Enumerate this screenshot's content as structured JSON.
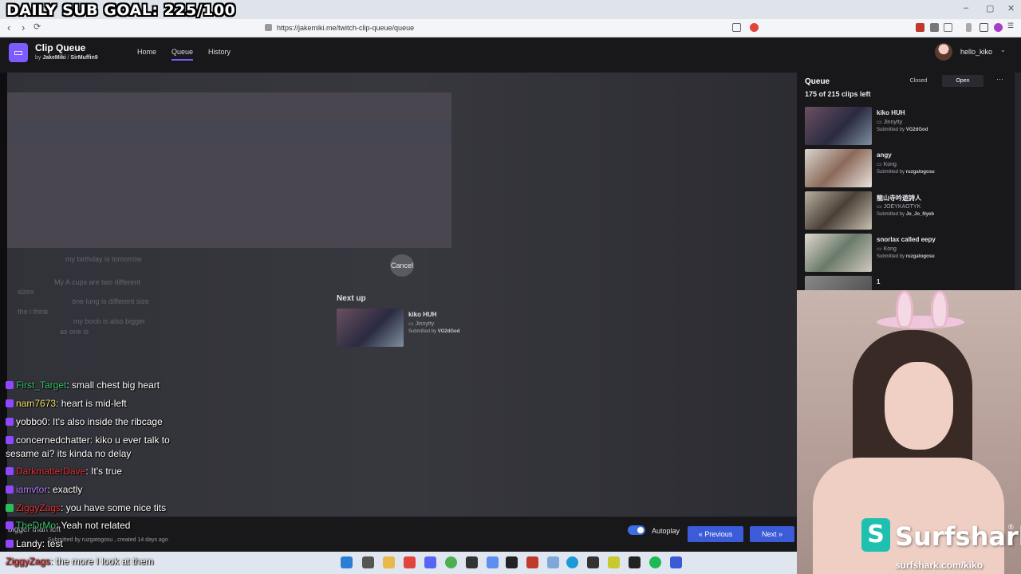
{
  "overlay": {
    "goal_text": "DAILY SUB GOAL: 225/100"
  },
  "browser": {
    "url": "https://jakemiki.me/twitch-clip-queue/queue",
    "nav": {
      "back": "‹",
      "forward": "›",
      "reload": "⟳"
    },
    "window": {
      "minimize": "–",
      "maximize": "▢",
      "close": "✕"
    }
  },
  "app": {
    "logo": "▭",
    "title": "Clip Queue",
    "by_prefix": "by",
    "author1": "JakeMiki",
    "separator": "/",
    "author2": "SirMuffin9",
    "nav": [
      {
        "label": "Home"
      },
      {
        "label": "Queue"
      },
      {
        "label": "History"
      }
    ],
    "user": {
      "name": "hello_kiko",
      "caret": "⌄"
    }
  },
  "player": {
    "cancel_label": "Cancel",
    "next_up_label": "Next up",
    "next_up": {
      "title": "kiko HUH",
      "creator": "Jinnytty",
      "submitted_prefix": "Submitted by",
      "submitted_by": "VG2dGod"
    },
    "clip_meta": "Submitted by ruzgatogosu , created 14 days ago"
  },
  "chat": [
    {
      "user": "First_Target",
      "message": "small chest big heart",
      "color": "#39c46a",
      "badge": "purple"
    },
    {
      "user": "nam7673",
      "message": "heart is mid-left",
      "color": "#f5e46b",
      "badge": "purple"
    },
    {
      "user": "yobbo0",
      "message": "It's also inside the ribcage",
      "color": "#ffffff",
      "badge": "purple"
    },
    {
      "user": "concernedchatter",
      "message": "kiko u ever talk to",
      "color": "#ffffff",
      "badge": "purple"
    },
    {
      "user": "",
      "message": "sesame ai? its kinda no delay",
      "color": "#ffffff",
      "badge": ""
    },
    {
      "user": "DarkmatterDave",
      "message": "It's true",
      "color": "#e23434",
      "badge": "purple"
    },
    {
      "user": "iamvtor",
      "message": "exactly",
      "color": "#b57cff",
      "badge": "purple"
    },
    {
      "user": "ZiggyZags",
      "message": "you have some nice tits",
      "color": "#e23434",
      "badge": "green"
    },
    {
      "user": "TheDrMo",
      "message": "Yeah not related",
      "color": "#39c46a",
      "badge": "purple"
    },
    {
      "user": "Landy",
      "message": "test",
      "color": "#ffffff",
      "badge": "purple"
    }
  ],
  "taskbar_chat": {
    "user": "ZiggyZags",
    "message": "the more I look at them",
    "color": "#e23434"
  },
  "ghost_chat": [
    "my birthday is tomorrow",
    "My A cups are two different",
    "sizes",
    "one lung is different size",
    "tho i think",
    "my boob is also bigger",
    "as one is"
  ],
  "ghost_overlay_text": [
    "bigger than left"
  ],
  "controls": {
    "autoplay_label": "Autoplay",
    "prev_label": "Previous",
    "prev_icon": "«",
    "next_label": "Next",
    "next_icon": "»"
  },
  "queue": {
    "title": "Queue",
    "closed_label": "Closed",
    "open_label": "Open",
    "more_icon": "⋯",
    "count_text": "175 of 215 clips left",
    "items": [
      {
        "title": "kiko HUH",
        "creator": "Jinnytty",
        "submitted_prefix": "Submitted by",
        "submitted_by": "VG2dGod"
      },
      {
        "title": "angy",
        "creator": "Kong",
        "submitted_prefix": "Submitted by",
        "submitted_by": "ruzgatogosu"
      },
      {
        "title": "龍山寺吟遊詩人",
        "creator": "JOEYKAOTYK",
        "submitted_prefix": "Submitted by",
        "submitted_by": "Jo_Jo_Nyeb"
      },
      {
        "title": "snorlax called eepy",
        "creator": "Kong",
        "submitted_prefix": "Submitted by",
        "submitted_by": "ruzgatogosu"
      },
      {
        "title": "1",
        "creator": "",
        "submitted_prefix": "",
        "submitted_by": ""
      }
    ]
  },
  "sponsor": {
    "logo": "S",
    "name": "Surfshark",
    "reg": "®",
    "url": "surfshark.com/kiko"
  }
}
